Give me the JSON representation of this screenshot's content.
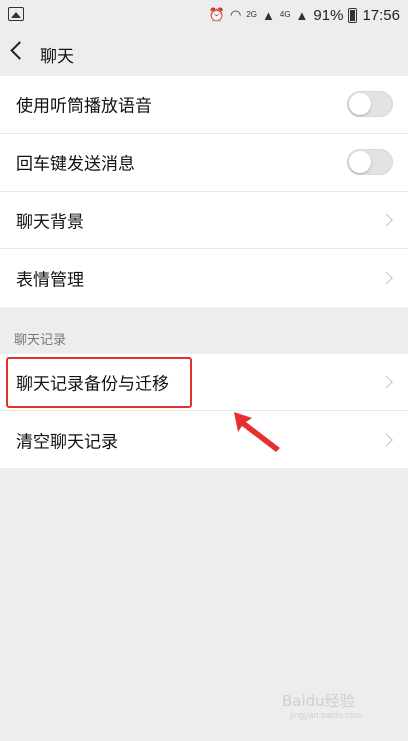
{
  "status_bar": {
    "battery": "91%",
    "time": "17:56",
    "net_labels": [
      "2G",
      "4G"
    ]
  },
  "header": {
    "title": "聊天"
  },
  "group1": {
    "items": [
      {
        "label": "使用听筒播放语音",
        "control": "toggle",
        "on": false
      },
      {
        "label": "回车键发送消息",
        "control": "toggle",
        "on": false
      },
      {
        "label": "聊天背景",
        "control": "chevron"
      },
      {
        "label": "表情管理",
        "control": "chevron"
      }
    ]
  },
  "chat_records": {
    "section_title": "聊天记录",
    "items": [
      {
        "label": "聊天记录备份与迁移",
        "control": "chevron"
      },
      {
        "label": "清空聊天记录",
        "control": "chevron"
      }
    ]
  },
  "annotation": {
    "highlight_color": "#e53030"
  },
  "watermark": {
    "text": "Baidu经验",
    "sub": "jingyan.baidu.com"
  }
}
